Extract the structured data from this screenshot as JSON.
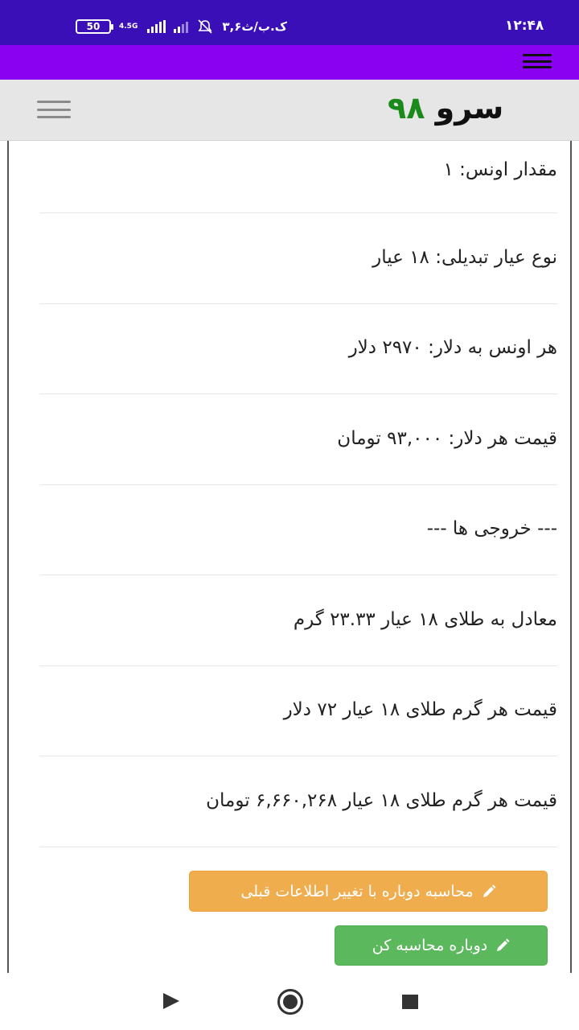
{
  "status_bar": {
    "time": "۱۲:۴۸",
    "battery": "50",
    "network": "4.5G",
    "carrier_speed": "۳,۶ک.ب/ث"
  },
  "site": {
    "logo_part1": "سرو",
    "logo_part2": "۹۸"
  },
  "rows": [
    "مقدار اونس: ۱",
    "نوع عیار تبدیلی: ۱۸ عیار",
    "هر اونس به دلار: ۲۹۷۰ دلار",
    "قیمت هر دلار: ۹۳,۰۰۰ تومان",
    "--- خروجی ها ---",
    "معادل به طلای ۱۸ عیار ۲۳.۳۳ گرم",
    "قیمت هر گرم طلای ۱۸ عیار ۷۲ دلار",
    "قیمت هر گرم طلای ۱۸ عیار ۶,۶۶۰,۲۶۸ تومان"
  ],
  "buttons": {
    "recalc_change": "محاسبه دوباره با تغییر اطلاعات قبلی",
    "recalc": "دوباره محاسبه کن"
  },
  "icons": {
    "menu": "hamburger-menu-icon",
    "pencil": "pencil-icon",
    "nav_back": "back-triangle-icon",
    "nav_home": "home-circle-icon",
    "nav_recent": "recent-apps-square-icon"
  },
  "colors": {
    "status_bar": "#3a0fb8",
    "app_bar": "#8a00f0",
    "logo_number": "#1a8a1a",
    "button_warning": "#f0ad4e",
    "button_success": "#5cb85c"
  }
}
